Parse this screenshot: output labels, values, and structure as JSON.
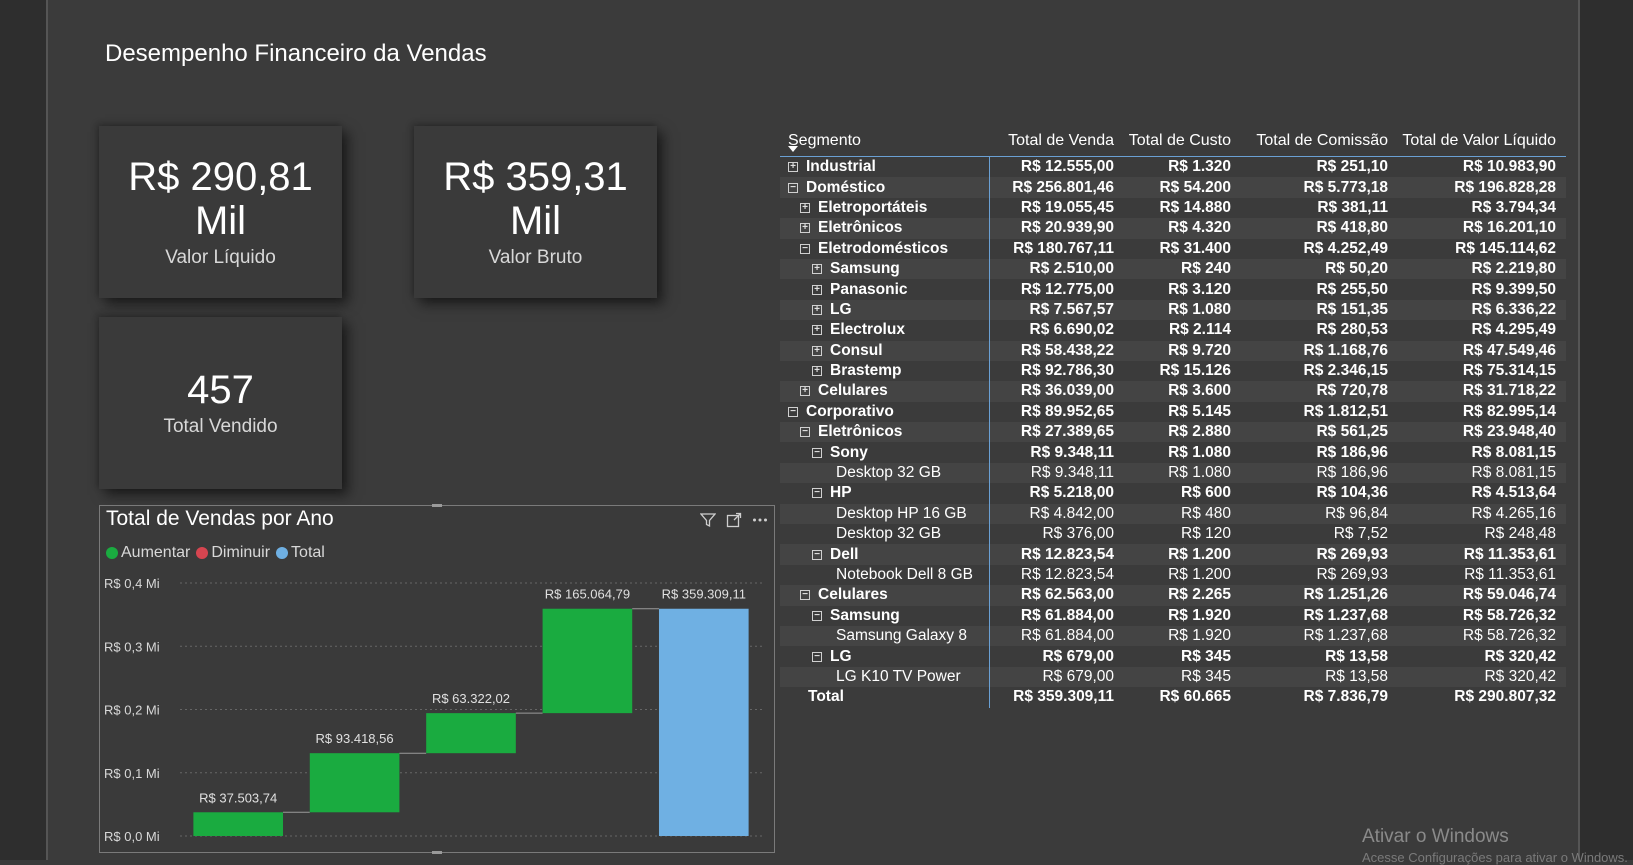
{
  "page": {
    "title": "Desempenho Financeiro da Vendas"
  },
  "kpis": [
    {
      "value": "R$ 290,81",
      "value2": "Mil",
      "label": "Valor Líquido"
    },
    {
      "value": "R$ 359,31",
      "value2": "Mil",
      "label": "Valor Bruto"
    },
    {
      "value": "457",
      "label": "Total Vendido"
    }
  ],
  "colors": {
    "increase": "#1aab40",
    "decrease": "#d64550",
    "total": "#6fb0e3",
    "accent_line": "#6aa0d4"
  },
  "chart": {
    "title": "Total de Vendas por Ano",
    "legend": [
      "Aumentar",
      "Diminuir",
      "Total"
    ],
    "icons": [
      "filter-icon",
      "focus-mode-icon",
      "more-options-icon"
    ]
  },
  "chart_data": {
    "type": "waterfall",
    "title": "Total de Vendas por Ano",
    "y_ticks": [
      "R$ 0,0 Mi",
      "R$ 0,1 Mi",
      "R$ 0,2 Mi",
      "R$ 0,3 Mi",
      "R$ 0,4 Mi"
    ],
    "ylim": [
      0,
      0.4
    ],
    "steps": [
      {
        "value": 0.03750374,
        "kind": "increase",
        "label": "R$ 37.503,74"
      },
      {
        "value": 0.09341856,
        "kind": "increase",
        "label": "R$ 93.418,56"
      },
      {
        "value": 0.06332202,
        "kind": "increase",
        "label": "R$ 63.322,02"
      },
      {
        "value": 0.16506479,
        "kind": "increase",
        "label": "R$ 165.064,79"
      },
      {
        "value": 0.35930911,
        "kind": "total",
        "label": "R$ 359.309,11"
      }
    ]
  },
  "matrix": {
    "headers": [
      "Segmento",
      "Total de Venda",
      "Total de Custo",
      "Total de Comissão",
      "Total de Valor Líquido"
    ],
    "rows": [
      {
        "level": 0,
        "expander": "+",
        "bold": true,
        "name": "Industrial",
        "venda": "R$ 12.555,00",
        "custo": "R$ 1.320",
        "comissao": "R$ 251,10",
        "liquido": "R$ 10.983,90"
      },
      {
        "level": 0,
        "expander": "-",
        "bold": true,
        "name": "Doméstico",
        "venda": "R$ 256.801,46",
        "custo": "R$ 54.200",
        "comissao": "R$ 5.773,18",
        "liquido": "R$ 196.828,28"
      },
      {
        "level": 1,
        "expander": "+",
        "bold": true,
        "name": "Eletroportáteis",
        "venda": "R$ 19.055,45",
        "custo": "R$ 14.880",
        "comissao": "R$ 381,11",
        "liquido": "R$ 3.794,34"
      },
      {
        "level": 1,
        "expander": "+",
        "bold": true,
        "name": "Eletrônicos",
        "venda": "R$ 20.939,90",
        "custo": "R$ 4.320",
        "comissao": "R$ 418,80",
        "liquido": "R$ 16.201,10"
      },
      {
        "level": 1,
        "expander": "-",
        "bold": true,
        "name": "Eletrodomésticos",
        "venda": "R$ 180.767,11",
        "custo": "R$ 31.400",
        "comissao": "R$ 4.252,49",
        "liquido": "R$ 145.114,62"
      },
      {
        "level": 2,
        "expander": "+",
        "bold": true,
        "name": "Samsung",
        "venda": "R$ 2.510,00",
        "custo": "R$ 240",
        "comissao": "R$ 50,20",
        "liquido": "R$ 2.219,80"
      },
      {
        "level": 2,
        "expander": "+",
        "bold": true,
        "name": "Panasonic",
        "venda": "R$ 12.775,00",
        "custo": "R$ 3.120",
        "comissao": "R$ 255,50",
        "liquido": "R$ 9.399,50"
      },
      {
        "level": 2,
        "expander": "+",
        "bold": true,
        "name": "LG",
        "venda": "R$ 7.567,57",
        "custo": "R$ 1.080",
        "comissao": "R$ 151,35",
        "liquido": "R$ 6.336,22"
      },
      {
        "level": 2,
        "expander": "+",
        "bold": true,
        "name": "Electrolux",
        "venda": "R$ 6.690,02",
        "custo": "R$ 2.114",
        "comissao": "R$ 280,53",
        "liquido": "R$ 4.295,49"
      },
      {
        "level": 2,
        "expander": "+",
        "bold": true,
        "name": "Consul",
        "venda": "R$ 58.438,22",
        "custo": "R$ 9.720",
        "comissao": "R$ 1.168,76",
        "liquido": "R$ 47.549,46"
      },
      {
        "level": 2,
        "expander": "+",
        "bold": true,
        "name": "Brastemp",
        "venda": "R$ 92.786,30",
        "custo": "R$ 15.126",
        "comissao": "R$ 2.346,15",
        "liquido": "R$ 75.314,15"
      },
      {
        "level": 1,
        "expander": "+",
        "bold": true,
        "name": "Celulares",
        "venda": "R$ 36.039,00",
        "custo": "R$ 3.600",
        "comissao": "R$ 720,78",
        "liquido": "R$ 31.718,22"
      },
      {
        "level": 0,
        "expander": "-",
        "bold": true,
        "name": "Corporativo",
        "venda": "R$ 89.952,65",
        "custo": "R$ 5.145",
        "comissao": "R$ 1.812,51",
        "liquido": "R$ 82.995,14"
      },
      {
        "level": 1,
        "expander": "-",
        "bold": true,
        "name": "Eletrônicos",
        "venda": "R$ 27.389,65",
        "custo": "R$ 2.880",
        "comissao": "R$ 561,25",
        "liquido": "R$ 23.948,40"
      },
      {
        "level": 2,
        "expander": "-",
        "bold": true,
        "name": "Sony",
        "venda": "R$ 9.348,11",
        "custo": "R$ 1.080",
        "comissao": "R$ 186,96",
        "liquido": "R$ 8.081,15"
      },
      {
        "level": 3,
        "expander": "",
        "bold": false,
        "name": "Desktop 32 GB",
        "venda": "R$ 9.348,11",
        "custo": "R$ 1.080",
        "comissao": "R$ 186,96",
        "liquido": "R$ 8.081,15"
      },
      {
        "level": 2,
        "expander": "-",
        "bold": true,
        "name": "HP",
        "venda": "R$ 5.218,00",
        "custo": "R$ 600",
        "comissao": "R$ 104,36",
        "liquido": "R$ 4.513,64"
      },
      {
        "level": 3,
        "expander": "",
        "bold": false,
        "name": "Desktop HP 16 GB",
        "venda": "R$ 4.842,00",
        "custo": "R$ 480",
        "comissao": "R$ 96,84",
        "liquido": "R$ 4.265,16"
      },
      {
        "level": 3,
        "expander": "",
        "bold": false,
        "name": "Desktop 32 GB",
        "venda": "R$ 376,00",
        "custo": "R$ 120",
        "comissao": "R$ 7,52",
        "liquido": "R$ 248,48"
      },
      {
        "level": 2,
        "expander": "-",
        "bold": true,
        "name": "Dell",
        "venda": "R$ 12.823,54",
        "custo": "R$ 1.200",
        "comissao": "R$ 269,93",
        "liquido": "R$ 11.353,61"
      },
      {
        "level": 3,
        "expander": "",
        "bold": false,
        "name": "Notebook Dell 8 GB",
        "venda": "R$ 12.823,54",
        "custo": "R$ 1.200",
        "comissao": "R$ 269,93",
        "liquido": "R$ 11.353,61"
      },
      {
        "level": 1,
        "expander": "-",
        "bold": true,
        "name": "Celulares",
        "venda": "R$ 62.563,00",
        "custo": "R$ 2.265",
        "comissao": "R$ 1.251,26",
        "liquido": "R$ 59.046,74"
      },
      {
        "level": 2,
        "expander": "-",
        "bold": true,
        "name": "Samsung",
        "venda": "R$ 61.884,00",
        "custo": "R$ 1.920",
        "comissao": "R$ 1.237,68",
        "liquido": "R$ 58.726,32"
      },
      {
        "level": 3,
        "expander": "",
        "bold": false,
        "name": "Samsung Galaxy 8",
        "venda": "R$ 61.884,00",
        "custo": "R$ 1.920",
        "comissao": "R$ 1.237,68",
        "liquido": "R$ 58.726,32"
      },
      {
        "level": 2,
        "expander": "-",
        "bold": true,
        "name": "LG",
        "venda": "R$ 679,00",
        "custo": "R$ 345",
        "comissao": "R$ 13,58",
        "liquido": "R$ 320,42"
      },
      {
        "level": 3,
        "expander": "",
        "bold": false,
        "name": "LG K10 TV Power",
        "venda": "R$ 679,00",
        "custo": "R$ 345",
        "comissao": "R$ 13,58",
        "liquido": "R$ 320,42"
      }
    ],
    "total": {
      "name": "Total",
      "venda": "R$ 359.309,11",
      "custo": "R$ 60.665",
      "comissao": "R$ 7.836,79",
      "liquido": "R$ 290.807,32"
    }
  },
  "watermark": {
    "line1": "Ativar o Windows",
    "line2": "Acesse Configurações para ativar o Windows."
  }
}
